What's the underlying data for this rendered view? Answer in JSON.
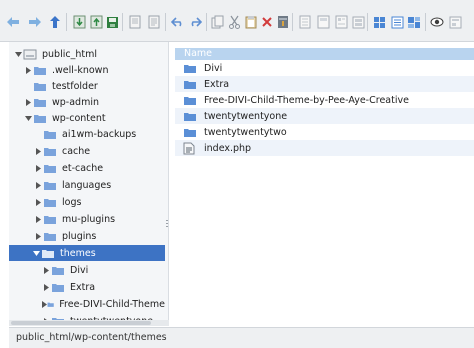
{
  "toolbar": {
    "buttons": [
      "back-icon",
      "forward-icon",
      "up-icon",
      "download-icon",
      "upload-icon",
      "save-icon",
      "copy-icon",
      "paste-icon",
      "undo-icon",
      "redo-icon",
      "duplicate-icon",
      "cut-icon",
      "clipboard-icon",
      "delete-icon",
      "archive-icon",
      "new-file-icon",
      "new-folder-icon",
      "properties-icon",
      "view-icons-icon",
      "view-list-icon",
      "view-tiles-icon",
      "preview-icon",
      "settings-icon",
      "help-icon"
    ]
  },
  "tree": {
    "root": "public_html",
    "items": [
      {
        "label": ".well-known"
      },
      {
        "label": "testfolder"
      },
      {
        "label": "wp-admin"
      },
      {
        "label": "wp-content"
      },
      {
        "label": "ai1wm-backups"
      },
      {
        "label": "cache"
      },
      {
        "label": "et-cache"
      },
      {
        "label": "languages"
      },
      {
        "label": "logs"
      },
      {
        "label": "mu-plugins"
      },
      {
        "label": "plugins"
      },
      {
        "label": "themes"
      },
      {
        "label": "Divi"
      },
      {
        "label": "Extra"
      },
      {
        "label": "Free-DIVI-Child-Theme"
      },
      {
        "label": "twentytwentyone"
      }
    ]
  },
  "file_list": {
    "column_header": "Name",
    "rows": [
      {
        "name": "Divi",
        "icon": "folder-icon"
      },
      {
        "name": "Extra",
        "icon": "folder-icon"
      },
      {
        "name": "Free-DIVI-Child-Theme-by-Pee-Aye-Creative",
        "icon": "folder-icon"
      },
      {
        "name": "twentytwentyone",
        "icon": "folder-icon"
      },
      {
        "name": "twentytwentytwo",
        "icon": "folder-icon"
      },
      {
        "name": "index.php",
        "icon": "php-file-icon"
      }
    ]
  },
  "status": {
    "path": "public_html/wp-content/themes"
  },
  "colors": {
    "selection": "#3d73c4",
    "folder": "#5b8fd6",
    "header": "#b9d4ef"
  }
}
